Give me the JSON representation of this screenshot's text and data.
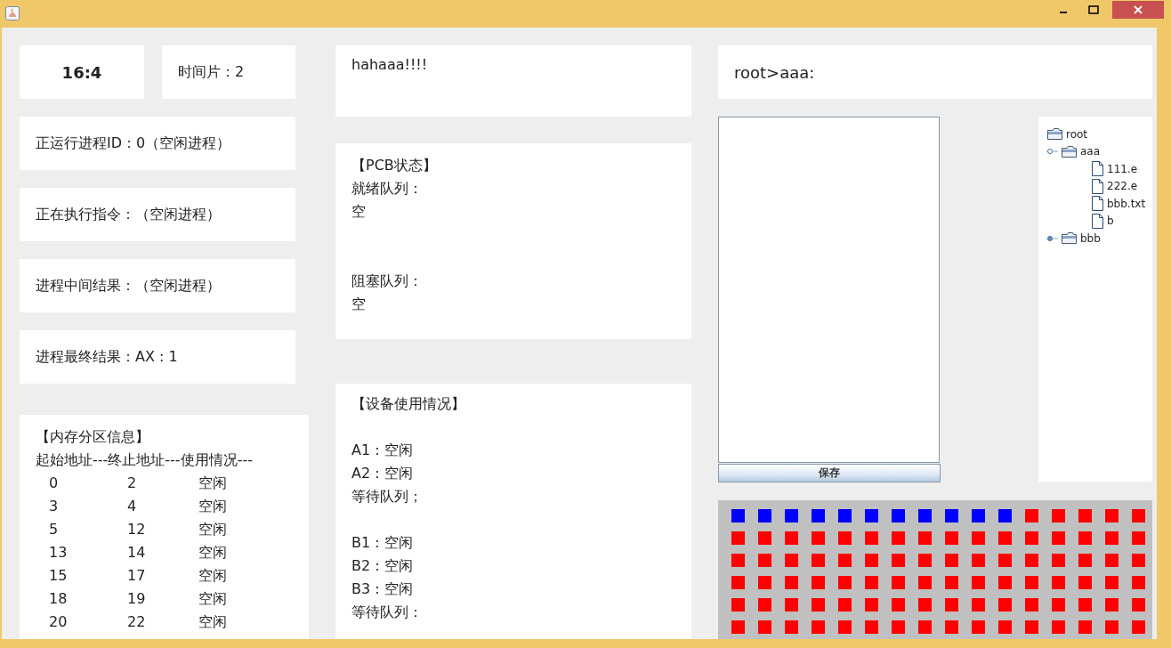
{
  "clock": "16:4",
  "time_slice": "时间片：2",
  "status_boxes": [
    "正运行进程ID：0（空闲进程）",
    "正在执行指令：（空闲进程）",
    "进程中间结果：（空闲进程）",
    "进程最终结果：AX : 1"
  ],
  "memory": {
    "title": "【内存分区信息】",
    "header": "起始地址---终止地址---使用情况---",
    "rows": [
      {
        "start": "0",
        "end": "2",
        "state": "空闲"
      },
      {
        "start": "3",
        "end": "4",
        "state": "空闲"
      },
      {
        "start": "5",
        "end": "12",
        "state": "空闲"
      },
      {
        "start": "13",
        "end": "14",
        "state": "空闲"
      },
      {
        "start": "15",
        "end": "17",
        "state": "空闲"
      },
      {
        "start": "18",
        "end": "19",
        "state": "空闲"
      },
      {
        "start": "20",
        "end": "22",
        "state": "空闲"
      }
    ]
  },
  "message": "hahaaa!!!!",
  "pcb": {
    "sections": [
      [
        "【PCB状态】",
        "就绪队列：",
        "空"
      ],
      [
        "阻塞队列：",
        "空"
      ]
    ]
  },
  "devices": {
    "sections": [
      [
        "【设备使用情况】"
      ],
      [
        "A1 : 空闲",
        "A2 : 空闲",
        "等待队列；"
      ],
      [
        "B1 : 空闲",
        "B2 : 空闲",
        "B3 : 空闲",
        "等待队列："
      ]
    ]
  },
  "path": "root>aaa:",
  "save_button": "保存",
  "tree": [
    {
      "label": "root",
      "kind": "folder",
      "children": [
        {
          "label": "aaa",
          "kind": "folder",
          "expanded": true,
          "children": [
            {
              "label": "111.e",
              "kind": "file"
            },
            {
              "label": "222.e",
              "kind": "file"
            },
            {
              "label": "bbb.txt",
              "kind": "file"
            },
            {
              "label": "b",
              "kind": "file"
            }
          ]
        },
        {
          "label": "bbb",
          "kind": "folder",
          "expanded": false
        }
      ]
    }
  ],
  "blocks": [
    {
      "color": "#0000ff"
    },
    {
      "color": "#0000ff"
    },
    {
      "color": "#0000ff"
    },
    {
      "color": "#0000ff"
    },
    {
      "color": "#0000ff"
    },
    {
      "color": "#0000ff"
    },
    {
      "color": "#0000ff"
    },
    {
      "color": "#0000ff"
    },
    {
      "color": "#0000ff"
    },
    {
      "color": "#0000ff"
    },
    {
      "color": "#0000ff"
    },
    {
      "color": "#ff0000"
    },
    {
      "color": "#ff0000"
    },
    {
      "color": "#ff0000"
    },
    {
      "color": "#ff0000"
    },
    {
      "color": "#ff0000"
    },
    {
      "color": "#ff0000"
    },
    {
      "color": "#ff0000"
    },
    {
      "color": "#ff0000"
    },
    {
      "color": "#ff0000"
    },
    {
      "color": "#ff0000"
    },
    {
      "color": "#ff0000"
    },
    {
      "color": "#ff0000"
    },
    {
      "color": "#ff0000"
    },
    {
      "color": "#ff0000"
    },
    {
      "color": "#ff0000"
    },
    {
      "color": "#ff0000"
    },
    {
      "color": "#ff0000"
    },
    {
      "color": "#ff0000"
    },
    {
      "color": "#ff0000"
    },
    {
      "color": "#ff0000"
    },
    {
      "color": "#ff0000"
    },
    {
      "color": "#ff0000"
    },
    {
      "color": "#ff0000"
    },
    {
      "color": "#ff0000"
    },
    {
      "color": "#ff0000"
    },
    {
      "color": "#ff0000"
    },
    {
      "color": "#ff0000"
    },
    {
      "color": "#ff0000"
    },
    {
      "color": "#ff0000"
    },
    {
      "color": "#ff0000"
    },
    {
      "color": "#ff0000"
    },
    {
      "color": "#ff0000"
    },
    {
      "color": "#ff0000"
    },
    {
      "color": "#ff0000"
    },
    {
      "color": "#ff0000"
    },
    {
      "color": "#ff0000"
    },
    {
      "color": "#ff0000"
    },
    {
      "color": "#ff0000"
    },
    {
      "color": "#ff0000"
    },
    {
      "color": "#ff0000"
    },
    {
      "color": "#ff0000"
    },
    {
      "color": "#ff0000"
    },
    {
      "color": "#ff0000"
    },
    {
      "color": "#ff0000"
    },
    {
      "color": "#ff0000"
    },
    {
      "color": "#ff0000"
    },
    {
      "color": "#ff0000"
    },
    {
      "color": "#ff0000"
    },
    {
      "color": "#ff0000"
    },
    {
      "color": "#ff0000"
    },
    {
      "color": "#ff0000"
    },
    {
      "color": "#ff0000"
    },
    {
      "color": "#ff0000"
    },
    {
      "color": "#ff0000"
    },
    {
      "color": "#ff0000"
    },
    {
      "color": "#ff0000"
    },
    {
      "color": "#ff0000"
    },
    {
      "color": "#ff0000"
    },
    {
      "color": "#ff0000"
    },
    {
      "color": "#ff0000"
    },
    {
      "color": "#ff0000"
    },
    {
      "color": "#ff0000"
    },
    {
      "color": "#ff0000"
    },
    {
      "color": "#ff0000"
    },
    {
      "color": "#ff0000"
    },
    {
      "color": "#ff0000"
    },
    {
      "color": "#ff0000"
    },
    {
      "color": "#ff0000"
    },
    {
      "color": "#ff0000"
    },
    {
      "color": "#ff0000"
    },
    {
      "color": "#ff0000"
    },
    {
      "color": "#ff0000"
    },
    {
      "color": "#ff0000"
    },
    {
      "color": "#ff0000"
    },
    {
      "color": "#ff0000"
    },
    {
      "color": "#ff0000"
    },
    {
      "color": "#ff0000"
    },
    {
      "color": "#ff0000"
    },
    {
      "color": "#ff0000"
    },
    {
      "color": "#ff0000"
    },
    {
      "color": "#ff0000"
    },
    {
      "color": "#ff0000"
    },
    {
      "color": "#ff0000"
    },
    {
      "color": "#ff0000"
    },
    {
      "color": "#ff0000"
    }
  ]
}
